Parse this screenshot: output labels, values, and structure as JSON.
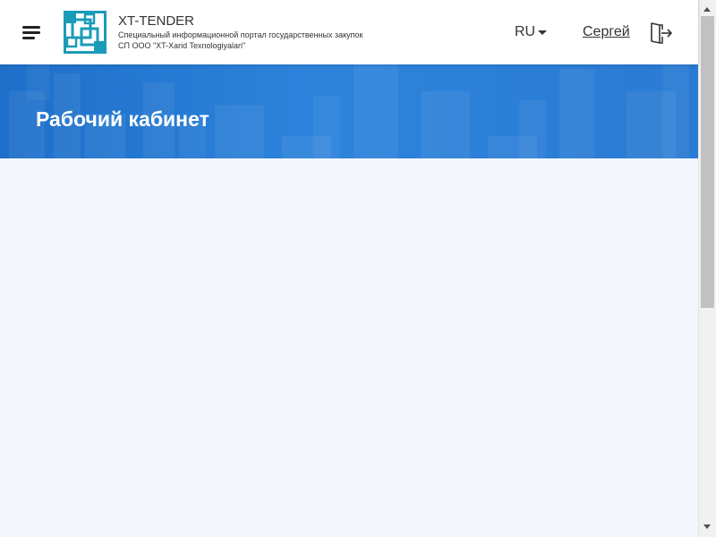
{
  "header": {
    "menu_icon": "hamburger-menu-icon",
    "logo_icon": "xt-tender-logo",
    "brand_title": "XT-TENDER",
    "brand_subtitle_line1": "Специальный информационной портал государственных закупок",
    "brand_subtitle_line2": "СП ООО \"XT-Xarid Texnologiyalari\"",
    "language": "RU",
    "user_name": "Сергей",
    "logout_icon": "logout-door-icon"
  },
  "banner": {
    "title": "Рабочий кабинет"
  },
  "colors": {
    "logo_teal": "#1a9bb8",
    "banner_blue": "#2a7bd3",
    "content_bg": "#f3f6fa"
  }
}
